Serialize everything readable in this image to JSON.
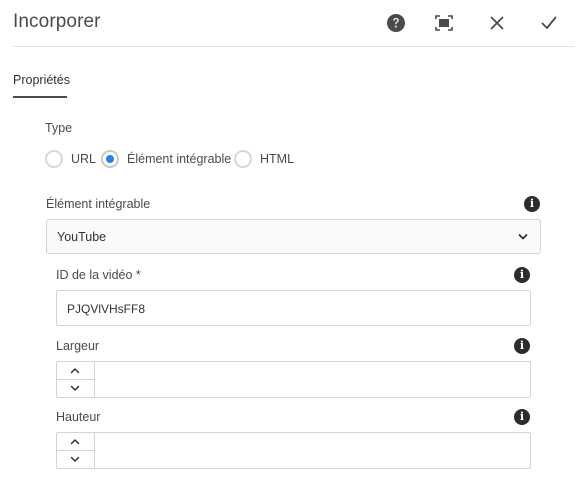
{
  "dialog": {
    "title": "Incorporer",
    "actions": {
      "help": "help-icon",
      "fullscreen": "fullscreen-icon",
      "close": "close-icon",
      "done": "checkmark-icon"
    }
  },
  "tabs": [
    {
      "label": "Propriétés",
      "active": true
    }
  ],
  "type_group": {
    "label": "Type",
    "options": [
      {
        "label": "URL",
        "checked": false
      },
      {
        "label": "Élément intégrable",
        "checked": true
      },
      {
        "label": "HTML",
        "checked": false
      }
    ]
  },
  "embeddable": {
    "label": "Élément intégrable",
    "selected": "YouTube"
  },
  "video_id": {
    "label": "ID de la vidéo *",
    "value": "PJQVlVHsFF8"
  },
  "width": {
    "label": "Largeur",
    "value": ""
  },
  "height": {
    "label": "Hauteur",
    "value": ""
  },
  "colors": {
    "accent": "#2680eb",
    "text": "#4b4b4b",
    "border": "#d3d3d3"
  }
}
